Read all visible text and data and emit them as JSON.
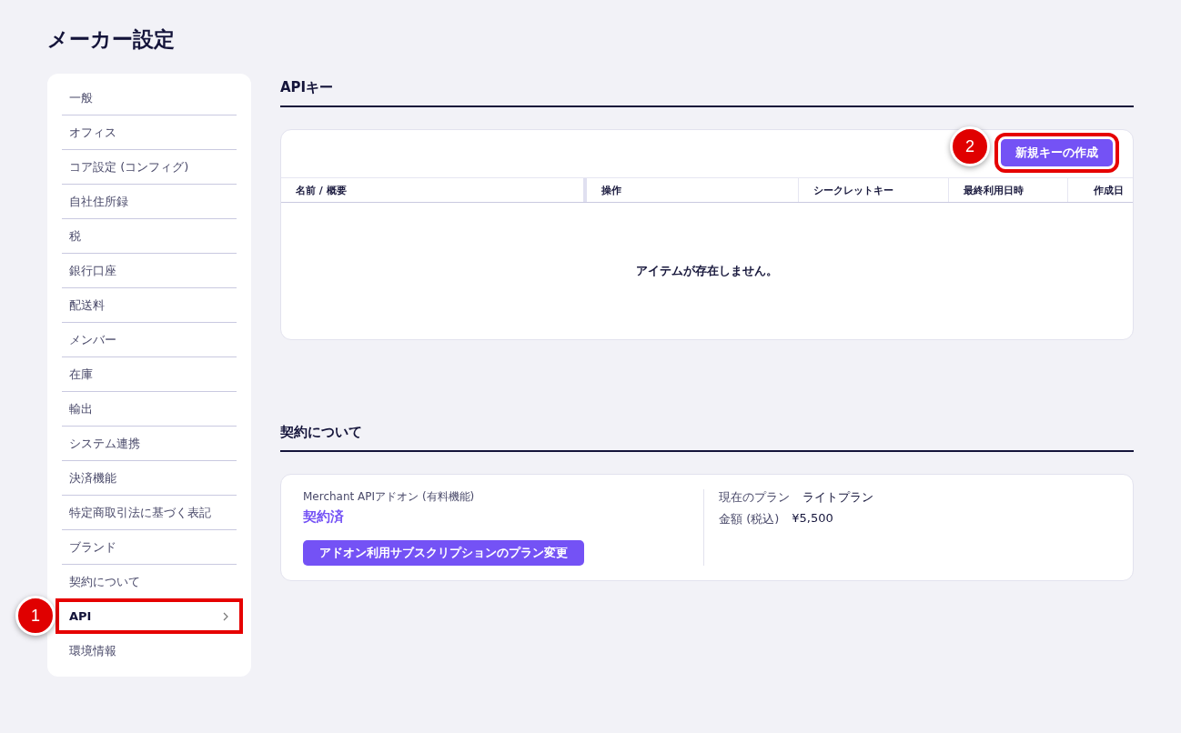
{
  "page_title": "メーカー設定",
  "sidebar": {
    "items": [
      {
        "label": "一般",
        "selected": false
      },
      {
        "label": "オフィス",
        "selected": false
      },
      {
        "label": "コア設定 (コンフィグ)",
        "selected": false
      },
      {
        "label": "自社住所録",
        "selected": false
      },
      {
        "label": "税",
        "selected": false
      },
      {
        "label": "銀行口座",
        "selected": false
      },
      {
        "label": "配送料",
        "selected": false
      },
      {
        "label": "メンバー",
        "selected": false
      },
      {
        "label": "在庫",
        "selected": false
      },
      {
        "label": "輸出",
        "selected": false
      },
      {
        "label": "システム連携",
        "selected": false
      },
      {
        "label": "決済機能",
        "selected": false
      },
      {
        "label": "特定商取引法に基づく表記",
        "selected": false
      },
      {
        "label": "ブランド",
        "selected": false
      },
      {
        "label": "契約について",
        "selected": false
      },
      {
        "label": "API",
        "selected": true,
        "callout": "1"
      },
      {
        "label": "環境情報",
        "selected": false
      }
    ]
  },
  "api_keys": {
    "heading": "APIキー",
    "create_button": {
      "label": "新規キーの作成",
      "callout": "2"
    },
    "columns": [
      "名前 / 概要",
      "操作",
      "シークレットキー",
      "最終利用日時",
      "作成日"
    ],
    "empty_message": "アイテムが存在しません。"
  },
  "contract": {
    "heading": "契約について",
    "addon_label": "Merchant APIアドオン (有料機能)",
    "status": "契約済",
    "change_button": "アドオン利用サブスクリプションのプラン変更",
    "details": [
      {
        "label": "現在のプラン",
        "value": "ライトプラン"
      },
      {
        "label": "金額 (税込)",
        "value": "¥5,500"
      }
    ]
  }
}
